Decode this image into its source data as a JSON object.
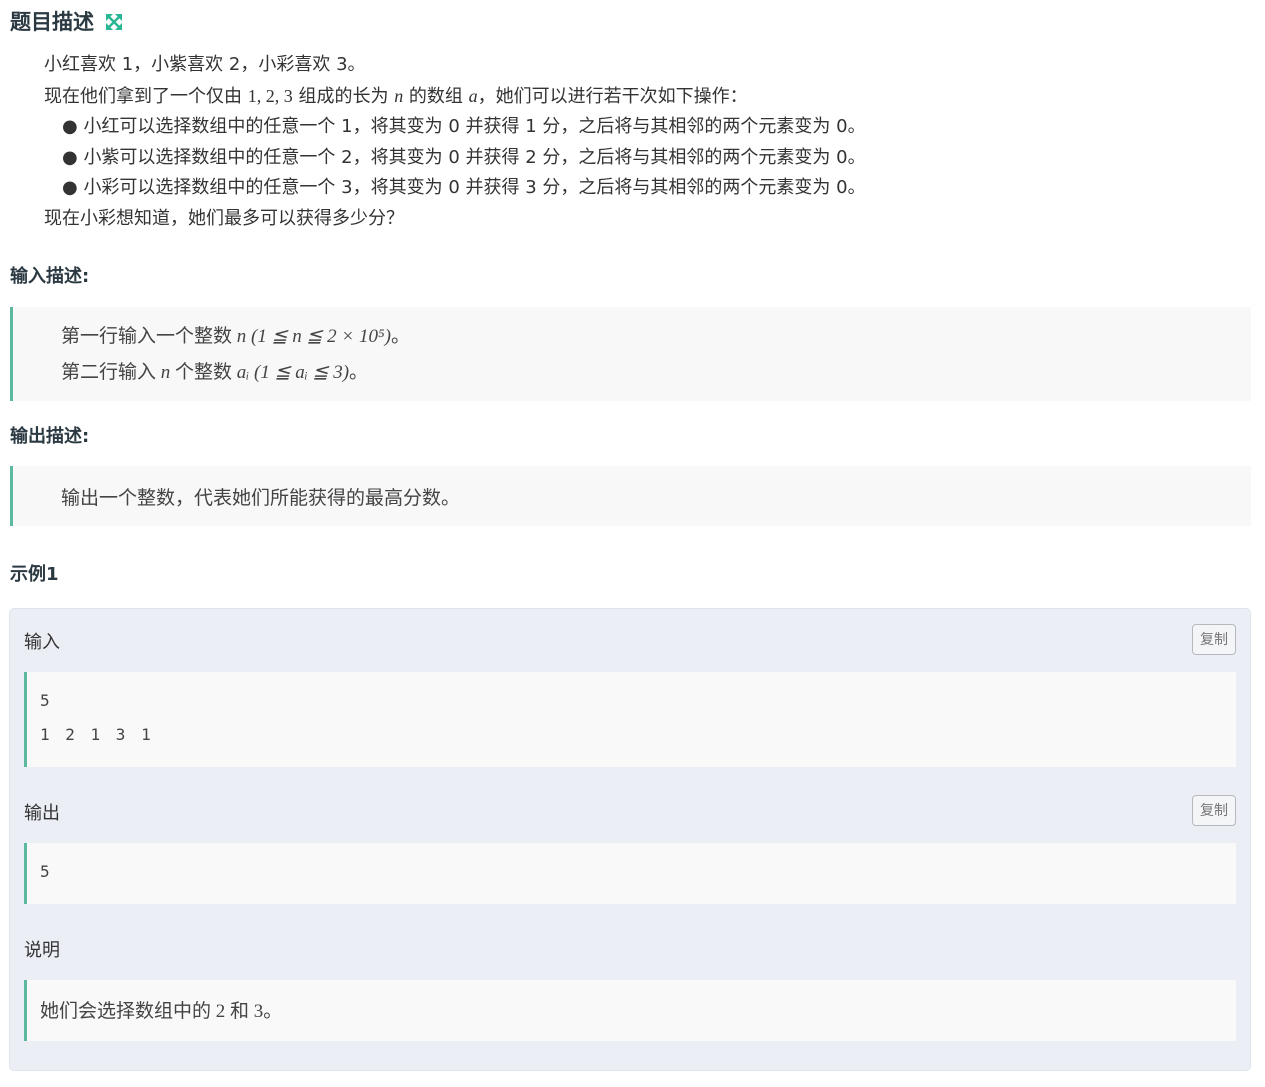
{
  "header": {
    "title": "题目描述",
    "expand_icon": "expand-arrows-icon",
    "accent": "#2ab595"
  },
  "description": {
    "line1": "小红喜欢 1，小紫喜欢 2，小彩喜欢 3。",
    "line2_prefix": "现在他们拿到了一个仅由 ",
    "line2_math1": "1, 2, 3",
    "line2_mid": " 组成的长为 ",
    "line2_n": "n",
    "line2_mid2": " 的数组 ",
    "line2_a": "a",
    "line2_suffix": "，她们可以进行若干次如下操作：",
    "bullets": [
      "小红可以选择数组中的任意一个 1，将其变为 0 并获得 1 分，之后将与其相邻的两个元素变为 0。",
      "小紫可以选择数组中的任意一个 2，将其变为 0 并获得 2 分，之后将与其相邻的两个元素变为 0。",
      "小彩可以选择数组中的任意一个 3，将其变为 0 并获得 3 分，之后将与其相邻的两个元素变为 0。"
    ],
    "question": "现在小彩想知道，她们最多可以获得多少分？"
  },
  "input_desc": {
    "title": "输入描述:",
    "line1_text": "第一行输入一个整数 ",
    "line1_math": "n (1 ≦ n ≦ 2 × 10⁵)",
    "line1_end": "。",
    "line2_text": "第二行输入 ",
    "line2_n": "n",
    "line2_mid": " 个整数 ",
    "line2_math": "aᵢ (1 ≦ aᵢ ≦ 3)",
    "line2_end": "。"
  },
  "output_desc": {
    "title": "输出描述:",
    "text": "输出一个整数，代表她们所能获得的最高分数。"
  },
  "example": {
    "title": "示例1",
    "input_label": "输入",
    "input_lines": [
      "5",
      "1 2 1 3 1"
    ],
    "output_label": "输出",
    "output_lines": [
      "5"
    ],
    "copy_label": "复制",
    "explain_label": "说明",
    "explain_text1": "她们会选择数组中的 ",
    "explain_num1": "2",
    "explain_and": " 和 ",
    "explain_num2": "3",
    "explain_end": "。"
  },
  "colors": {
    "quote_border": "#5cb89e",
    "example_bg": "#ebeff5"
  }
}
